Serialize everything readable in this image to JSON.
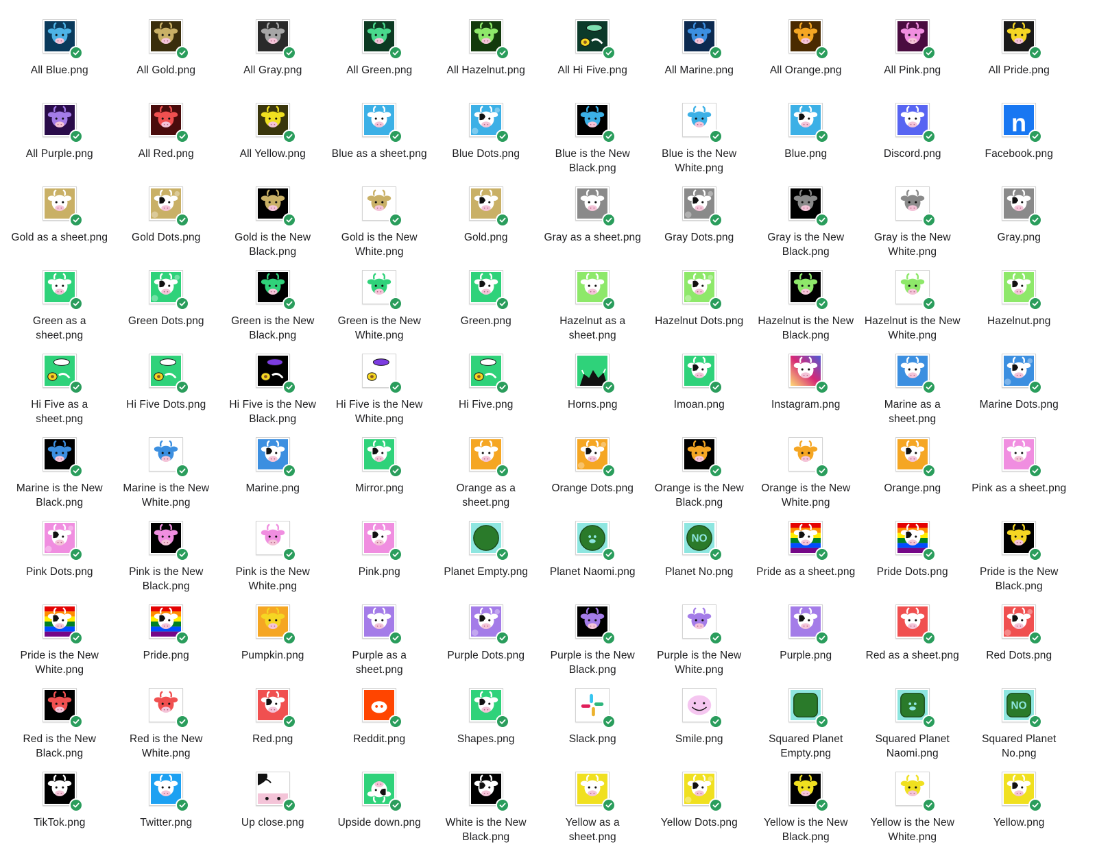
{
  "files": [
    {
      "name": "All Blue.png",
      "thumb": {
        "bg": "#0a3a5c",
        "cow": "#4db3e6",
        "style": "cow"
      }
    },
    {
      "name": "All Gold.png",
      "thumb": {
        "bg": "#3a2e0c",
        "cow": "#c9b066",
        "style": "cow"
      }
    },
    {
      "name": "All Gray.png",
      "thumb": {
        "bg": "#2a2a2a",
        "cow": "#a6a6a6",
        "style": "cow"
      }
    },
    {
      "name": "All Green.png",
      "thumb": {
        "bg": "#0c3a22",
        "cow": "#49d98c",
        "style": "cow"
      }
    },
    {
      "name": "All Hazelnut.png",
      "thumb": {
        "bg": "#133a0c",
        "cow": "#8ee86a",
        "style": "cow"
      }
    },
    {
      "name": "All Hi Five.png",
      "thumb": {
        "bg": "#0c3a2a",
        "cow": "#7de0b0",
        "style": "food"
      }
    },
    {
      "name": "All Marine.png",
      "thumb": {
        "bg": "#0c2a50",
        "cow": "#3c8fe0",
        "style": "cow"
      }
    },
    {
      "name": "All Orange.png",
      "thumb": {
        "bg": "#4a2a00",
        "cow": "#f5a623",
        "style": "cow"
      }
    },
    {
      "name": "All Pink.png",
      "thumb": {
        "bg": "#4a0c40",
        "cow": "#f08ee0",
        "style": "cow"
      }
    },
    {
      "name": "All Pride.png",
      "thumb": {
        "bg": "#1a1a1a",
        "cow": "#f5d623",
        "style": "cow"
      }
    },
    {
      "name": "All Purple.png",
      "thumb": {
        "bg": "#2a0c4a",
        "cow": "#a47ce8",
        "style": "cow"
      }
    },
    {
      "name": "All Red.png",
      "thumb": {
        "bg": "#4a0c0c",
        "cow": "#f05050",
        "style": "cow"
      }
    },
    {
      "name": "All Yellow.png",
      "thumb": {
        "bg": "#3a360c",
        "cow": "#f0e020",
        "style": "cow"
      }
    },
    {
      "name": "Blue as a sheet.png",
      "thumb": {
        "bg": "#3cb0e6",
        "cow": "#ffffff",
        "style": "cow"
      }
    },
    {
      "name": "Blue Dots.png",
      "thumb": {
        "bg": "#3cb0e6",
        "cow": "#ffffff",
        "style": "dots"
      }
    },
    {
      "name": "Blue is the New Black.png",
      "thumb": {
        "bg": "#000000",
        "cow": "#3cb0e6",
        "style": "cow"
      }
    },
    {
      "name": "Blue is the New White.png",
      "thumb": {
        "bg": "#ffffff",
        "cow": "#3cb0e6",
        "style": "cow"
      }
    },
    {
      "name": "Blue.png",
      "thumb": {
        "bg": "#3cb0e6",
        "cow": "#ffffff",
        "style": "spots"
      }
    },
    {
      "name": "Discord.png",
      "thumb": {
        "bg": "#5865f2",
        "cow": "#ffffff",
        "style": "cow"
      }
    },
    {
      "name": "Facebook.png",
      "thumb": {
        "bg": "#1877f2",
        "cow": "#ffffff",
        "style": "letter",
        "letter": "n"
      }
    },
    {
      "name": "Gold as a sheet.png",
      "thumb": {
        "bg": "#c9b066",
        "cow": "#ffffff",
        "style": "cow"
      }
    },
    {
      "name": "Gold Dots.png",
      "thumb": {
        "bg": "#c9b066",
        "cow": "#ffffff",
        "style": "dots"
      }
    },
    {
      "name": "Gold is the New Black.png",
      "thumb": {
        "bg": "#000000",
        "cow": "#c9b066",
        "style": "cow"
      }
    },
    {
      "name": "Gold is the New White.png",
      "thumb": {
        "bg": "#ffffff",
        "cow": "#c9b066",
        "style": "cow"
      }
    },
    {
      "name": "Gold.png",
      "thumb": {
        "bg": "#c9b066",
        "cow": "#ffffff",
        "style": "spots"
      }
    },
    {
      "name": "Gray as a sheet.png",
      "thumb": {
        "bg": "#8a8a8a",
        "cow": "#ffffff",
        "style": "cow"
      }
    },
    {
      "name": "Gray Dots.png",
      "thumb": {
        "bg": "#8a8a8a",
        "cow": "#ffffff",
        "style": "dots"
      }
    },
    {
      "name": "Gray is the New Black.png",
      "thumb": {
        "bg": "#000000",
        "cow": "#8a8a8a",
        "style": "cow"
      }
    },
    {
      "name": "Gray is the New White.png",
      "thumb": {
        "bg": "#ffffff",
        "cow": "#8a8a8a",
        "style": "cow"
      }
    },
    {
      "name": "Gray.png",
      "thumb": {
        "bg": "#8a8a8a",
        "cow": "#ffffff",
        "style": "spots"
      }
    },
    {
      "name": "Green as a sheet.png",
      "thumb": {
        "bg": "#2fd27a",
        "cow": "#ffffff",
        "style": "cow"
      }
    },
    {
      "name": "Green Dots.png",
      "thumb": {
        "bg": "#2fd27a",
        "cow": "#ffffff",
        "style": "dots"
      }
    },
    {
      "name": "Green is the New Black.png",
      "thumb": {
        "bg": "#000000",
        "cow": "#2fd27a",
        "style": "cow"
      }
    },
    {
      "name": "Green is the New White.png",
      "thumb": {
        "bg": "#ffffff",
        "cow": "#2fd27a",
        "style": "cow"
      }
    },
    {
      "name": "Green.png",
      "thumb": {
        "bg": "#2fd27a",
        "cow": "#ffffff",
        "style": "spots"
      }
    },
    {
      "name": "Hazelnut as a sheet.png",
      "thumb": {
        "bg": "#8ee86a",
        "cow": "#ffffff",
        "style": "cow"
      }
    },
    {
      "name": "Hazelnut Dots.png",
      "thumb": {
        "bg": "#8ee86a",
        "cow": "#ffffff",
        "style": "dots"
      }
    },
    {
      "name": "Hazelnut is the New Black.png",
      "thumb": {
        "bg": "#000000",
        "cow": "#8ee86a",
        "style": "cow"
      }
    },
    {
      "name": "Hazelnut is the New White.png",
      "thumb": {
        "bg": "#ffffff",
        "cow": "#8ee86a",
        "style": "cow"
      }
    },
    {
      "name": "Hazelnut.png",
      "thumb": {
        "bg": "#8ee86a",
        "cow": "#ffffff",
        "style": "spots"
      }
    },
    {
      "name": "Hi Five as a sheet.png",
      "thumb": {
        "bg": "#2fd27a",
        "cow": "#ffffff",
        "style": "food"
      }
    },
    {
      "name": "Hi Five Dots.png",
      "thumb": {
        "bg": "#2fd27a",
        "cow": "#ffffff",
        "style": "food"
      }
    },
    {
      "name": "Hi Five is the New Black.png",
      "thumb": {
        "bg": "#000000",
        "cow": "#7c3ce0",
        "style": "food"
      }
    },
    {
      "name": "Hi Five is the New White.png",
      "thumb": {
        "bg": "#ffffff",
        "cow": "#7c3ce0",
        "style": "food"
      }
    },
    {
      "name": "Hi Five.png",
      "thumb": {
        "bg": "#2fd27a",
        "cow": "#ffffff",
        "style": "food"
      }
    },
    {
      "name": "Horns.png",
      "thumb": {
        "bg": "#2fd27a",
        "cow": "#000000",
        "style": "horns"
      }
    },
    {
      "name": "Imoan.png",
      "thumb": {
        "bg": "#2fd27a",
        "cow": "#ffffff",
        "style": "spots"
      }
    },
    {
      "name": "Instagram.png",
      "thumb": {
        "bg": "#e1306c",
        "cow": "#ffffff",
        "style": "insta"
      }
    },
    {
      "name": "Marine as a sheet.png",
      "thumb": {
        "bg": "#3c8fe0",
        "cow": "#ffffff",
        "style": "cow"
      }
    },
    {
      "name": "Marine Dots.png",
      "thumb": {
        "bg": "#3c8fe0",
        "cow": "#ffffff",
        "style": "dots"
      }
    },
    {
      "name": "Marine is the New Black.png",
      "thumb": {
        "bg": "#000000",
        "cow": "#3c8fe0",
        "style": "cow"
      }
    },
    {
      "name": "Marine is the New White.png",
      "thumb": {
        "bg": "#ffffff",
        "cow": "#3c8fe0",
        "style": "cow"
      }
    },
    {
      "name": "Marine.png",
      "thumb": {
        "bg": "#3c8fe0",
        "cow": "#ffffff",
        "style": "spots"
      }
    },
    {
      "name": "Mirror.png",
      "thumb": {
        "bg": "#2fd27a",
        "cow": "#ffffff",
        "style": "spots"
      }
    },
    {
      "name": "Orange as a sheet.png",
      "thumb": {
        "bg": "#f5a623",
        "cow": "#ffffff",
        "style": "cow"
      }
    },
    {
      "name": "Orange Dots.png",
      "thumb": {
        "bg": "#f5a623",
        "cow": "#ffffff",
        "style": "dots"
      }
    },
    {
      "name": "Orange is the New Black.png",
      "thumb": {
        "bg": "#000000",
        "cow": "#f5a623",
        "style": "cow"
      }
    },
    {
      "name": "Orange is the New White.png",
      "thumb": {
        "bg": "#ffffff",
        "cow": "#f5a623",
        "style": "cow"
      }
    },
    {
      "name": "Orange.png",
      "thumb": {
        "bg": "#f5a623",
        "cow": "#ffffff",
        "style": "spots"
      }
    },
    {
      "name": "Pink as a sheet.png",
      "thumb": {
        "bg": "#f08ee0",
        "cow": "#ffffff",
        "style": "cow"
      }
    },
    {
      "name": "Pink Dots.png",
      "thumb": {
        "bg": "#f08ee0",
        "cow": "#ffffff",
        "style": "dots"
      }
    },
    {
      "name": "Pink is the New Black.png",
      "thumb": {
        "bg": "#000000",
        "cow": "#f08ee0",
        "style": "cow"
      }
    },
    {
      "name": "Pink is the New White.png",
      "thumb": {
        "bg": "#ffffff",
        "cow": "#f08ee0",
        "style": "cow"
      }
    },
    {
      "name": "Pink.png",
      "thumb": {
        "bg": "#f08ee0",
        "cow": "#ffffff",
        "style": "spots"
      }
    },
    {
      "name": "Planet Empty.png",
      "thumb": {
        "bg": "#8ee6e0",
        "cow": "#2a7a2a",
        "style": "planet"
      }
    },
    {
      "name": "Planet Naomi.png",
      "thumb": {
        "bg": "#8ee6e0",
        "cow": "#2a7a2a",
        "style": "planet-cow"
      }
    },
    {
      "name": "Planet No.png",
      "thumb": {
        "bg": "#8ee6e0",
        "cow": "#2a7a2a",
        "style": "planet-no",
        "letter": "NO"
      }
    },
    {
      "name": "Pride as a sheet.png",
      "thumb": {
        "bg": "#f5d623",
        "cow": "#ffffff",
        "style": "pride"
      }
    },
    {
      "name": "Pride Dots.png",
      "thumb": {
        "bg": "#f5d623",
        "cow": "#ffffff",
        "style": "pride"
      }
    },
    {
      "name": "Pride is the New Black.png",
      "thumb": {
        "bg": "#000000",
        "cow": "#f5d623",
        "style": "cow"
      }
    },
    {
      "name": "Pride is the New White.png",
      "thumb": {
        "bg": "#ffffff",
        "cow": "#f5d623",
        "style": "pride"
      }
    },
    {
      "name": "Pride.png",
      "thumb": {
        "bg": "#f5d623",
        "cow": "#ffffff",
        "style": "pride"
      }
    },
    {
      "name": "Pumpkin.png",
      "thumb": {
        "bg": "#f5a623",
        "cow": "#f5d623",
        "style": "cow"
      }
    },
    {
      "name": "Purple as a sheet.png",
      "thumb": {
        "bg": "#a47ce8",
        "cow": "#ffffff",
        "style": "cow"
      }
    },
    {
      "name": "Purple Dots.png",
      "thumb": {
        "bg": "#a47ce8",
        "cow": "#ffffff",
        "style": "dots"
      }
    },
    {
      "name": "Purple is the New Black.png",
      "thumb": {
        "bg": "#000000",
        "cow": "#a47ce8",
        "style": "cow"
      }
    },
    {
      "name": "Purple is the New White.png",
      "thumb": {
        "bg": "#ffffff",
        "cow": "#a47ce8",
        "style": "cow"
      }
    },
    {
      "name": "Purple.png",
      "thumb": {
        "bg": "#a47ce8",
        "cow": "#ffffff",
        "style": "spots"
      }
    },
    {
      "name": "Red as a sheet.png",
      "thumb": {
        "bg": "#f05050",
        "cow": "#ffffff",
        "style": "cow"
      }
    },
    {
      "name": "Red Dots.png",
      "thumb": {
        "bg": "#f05050",
        "cow": "#ffffff",
        "style": "dots"
      }
    },
    {
      "name": "Red is the New Black.png",
      "thumb": {
        "bg": "#000000",
        "cow": "#f05050",
        "style": "cow"
      }
    },
    {
      "name": "Red is the New White.png",
      "thumb": {
        "bg": "#ffffff",
        "cow": "#f05050",
        "style": "cow"
      }
    },
    {
      "name": "Red.png",
      "thumb": {
        "bg": "#f05050",
        "cow": "#ffffff",
        "style": "spots"
      }
    },
    {
      "name": "Reddit.png",
      "thumb": {
        "bg": "#ff4500",
        "cow": "#ffffff",
        "style": "reddit"
      }
    },
    {
      "name": "Shapes.png",
      "thumb": {
        "bg": "#2fd27a",
        "cow": "#ffffff",
        "style": "spots"
      }
    },
    {
      "name": "Slack.png",
      "thumb": {
        "bg": "#ffffff",
        "cow": "#e01e5a",
        "style": "slack"
      }
    },
    {
      "name": "Smile.png",
      "thumb": {
        "bg": "#ffffff",
        "cow": "#f5c6f0",
        "style": "smile"
      }
    },
    {
      "name": "Squared Planet Empty.png",
      "thumb": {
        "bg": "#8ee6e0",
        "cow": "#2a7a2a",
        "style": "sq-planet"
      }
    },
    {
      "name": "Squared Planet Naomi.png",
      "thumb": {
        "bg": "#8ee6e0",
        "cow": "#2a7a2a",
        "style": "sq-planet-cow"
      }
    },
    {
      "name": "Squared Planet No.png",
      "thumb": {
        "bg": "#8ee6e0",
        "cow": "#2a7a2a",
        "style": "sq-planet-no",
        "letter": "NO"
      }
    },
    {
      "name": "TikTok.png",
      "thumb": {
        "bg": "#000000",
        "cow": "#ffffff",
        "style": "cow"
      }
    },
    {
      "name": "Twitter.png",
      "thumb": {
        "bg": "#1da1f2",
        "cow": "#ffffff",
        "style": "cow"
      }
    },
    {
      "name": "Up close.png",
      "thumb": {
        "bg": "#ffffff",
        "cow": "#000000",
        "style": "upclose"
      }
    },
    {
      "name": "Upside down.png",
      "thumb": {
        "bg": "#2fd27a",
        "cow": "#ffffff",
        "style": "upside"
      }
    },
    {
      "name": "White is the New Black.png",
      "thumb": {
        "bg": "#000000",
        "cow": "#ffffff",
        "style": "spots"
      }
    },
    {
      "name": "Yellow as a sheet.png",
      "thumb": {
        "bg": "#f0e020",
        "cow": "#ffffff",
        "style": "cow"
      }
    },
    {
      "name": "Yellow Dots.png",
      "thumb": {
        "bg": "#f0e020",
        "cow": "#ffffff",
        "style": "dots"
      }
    },
    {
      "name": "Yellow is the New Black.png",
      "thumb": {
        "bg": "#000000",
        "cow": "#f0e020",
        "style": "cow"
      }
    },
    {
      "name": "Yellow is the New White.png",
      "thumb": {
        "bg": "#ffffff",
        "cow": "#f0e020",
        "style": "cow"
      }
    },
    {
      "name": "Yellow.png",
      "thumb": {
        "bg": "#f0e020",
        "cow": "#ffffff",
        "style": "spots"
      }
    }
  ],
  "status_icon": "synced-checkmark-icon",
  "status_color": "#2a9d5c"
}
